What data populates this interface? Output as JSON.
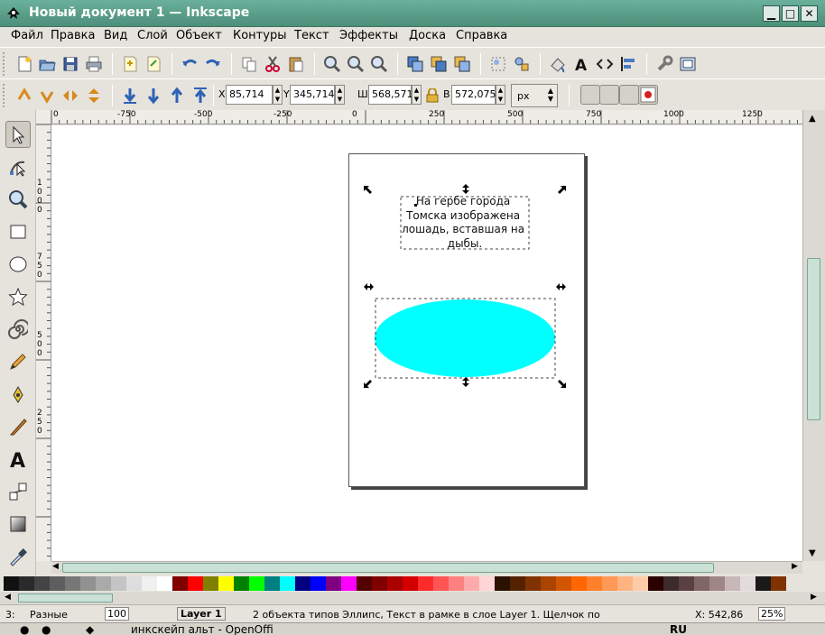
{
  "window": {
    "title": "Новый документ 1 — Inkscape",
    "minimize": "▁",
    "maximize": "□",
    "close": "✕"
  },
  "menu": [
    "Файл",
    "Правка",
    "Вид",
    "Слой",
    "Объект",
    "Контуры",
    "Текст",
    "Эффекты",
    "Доска",
    "Справка"
  ],
  "controls": {
    "x_label": "X",
    "x_value": "85,714",
    "y_label": "Y",
    "y_value": "345,714",
    "w_label": "Ш",
    "w_value": "568,571",
    "h_label": "В",
    "h_value": "572,075",
    "unit": "px"
  },
  "ruler": {
    "h_labels": [
      "0",
      "-750",
      "-500",
      "-250",
      "0",
      "250",
      "500",
      "750",
      "1000",
      "1250"
    ],
    "v_labels": [
      "1",
      "0",
      "0",
      "0",
      "7",
      "5",
      "0",
      "5",
      "0",
      "0",
      "2",
      "5",
      "0"
    ]
  },
  "canvas": {
    "text_lines": [
      "На гербе города",
      "Томска изображена",
      "лошадь, вставшая на",
      "дыбы."
    ],
    "ellipse_color": "#00ffff"
  },
  "palette": [
    "#111111",
    "#2a2a2a",
    "#444444",
    "#5e5e5e",
    "#777777",
    "#919191",
    "#aaaaaa",
    "#c4c4c4",
    "#dddddd",
    "#f0f0f0",
    "#ffffff",
    "#800000",
    "#ff0000",
    "#808000",
    "#ffff00",
    "#008000",
    "#00ff00",
    "#008080",
    "#00ffff",
    "#000080",
    "#0000ff",
    "#800080",
    "#ff00ff",
    "#550000",
    "#800000",
    "#aa0000",
    "#d40000",
    "#ff2a2a",
    "#ff5555",
    "#ff8080",
    "#ffaaaa",
    "#ffd5d5",
    "#2b1100",
    "#552200",
    "#803300",
    "#aa4400",
    "#d45500",
    "#ff6600",
    "#ff7f2a",
    "#ff9955",
    "#ffb380",
    "#ffccaa",
    "#2b0000",
    "#3d2a2a",
    "#5a4040",
    "#806666",
    "#a08585",
    "#c8b7b7",
    "#e3dbdb",
    "#1a1a1a",
    "#803300"
  ],
  "status": {
    "layer_num": "3:",
    "stroke": "Разные",
    "opacity": "100",
    "layer": "Layer 1",
    "message": "2 объекта типов Эллипс, Текст в рамке в слое Layer 1. Щелчок по",
    "coords": "X: 542,86",
    "zoom": "25%"
  },
  "taskbar": {
    "task": "инкскейп альт - OpenOffi",
    "lang": "RU"
  }
}
